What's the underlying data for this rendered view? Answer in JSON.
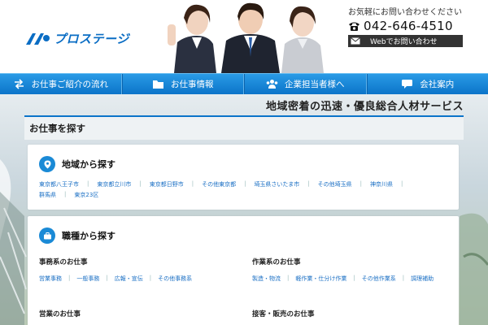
{
  "brand": {
    "name": "プロステージ",
    "color": "#0a6dc4"
  },
  "contact": {
    "lead": "お気軽にお問い合わせください",
    "phone": "042-646-4510",
    "web_button": "Webでお問い合わせ"
  },
  "nav": {
    "items": [
      {
        "label": "お仕事ご紹介の流れ",
        "icon": "exchange-icon"
      },
      {
        "label": "お仕事情報",
        "icon": "folder-icon"
      },
      {
        "label": "企業担当者様へ",
        "icon": "users-icon"
      },
      {
        "label": "会社案内",
        "icon": "chat-icon"
      }
    ]
  },
  "tagline": "地域密着の迅速・優良総合人材サービス",
  "search": {
    "title": "お仕事を探す"
  },
  "area": {
    "title": "地域から探す",
    "icon": "map-pin-icon",
    "links": [
      "東京都八王子市",
      "東京都立川市",
      "東京都日野市",
      "その他東京都",
      "埼玉県さいたま市",
      "その他埼玉県",
      "神奈川県",
      "群馬県",
      "東京23区"
    ]
  },
  "job": {
    "title": "職種から探す",
    "icon": "briefcase-icon",
    "groups": [
      {
        "title": "事務系のお仕事",
        "links": [
          "営業事務",
          "一般事務",
          "広報・宣伝",
          "その他事務系"
        ]
      },
      {
        "title": "作業系のお仕事",
        "links": [
          "製造・物流",
          "軽作業・仕分け作業",
          "その他作業系",
          "調理補助"
        ]
      },
      {
        "title": "営業のお仕事",
        "links": []
      },
      {
        "title": "接客・販売のお仕事",
        "links": []
      }
    ]
  },
  "colors": {
    "accent": "#0b74c9",
    "link": "#1a6fc4"
  }
}
